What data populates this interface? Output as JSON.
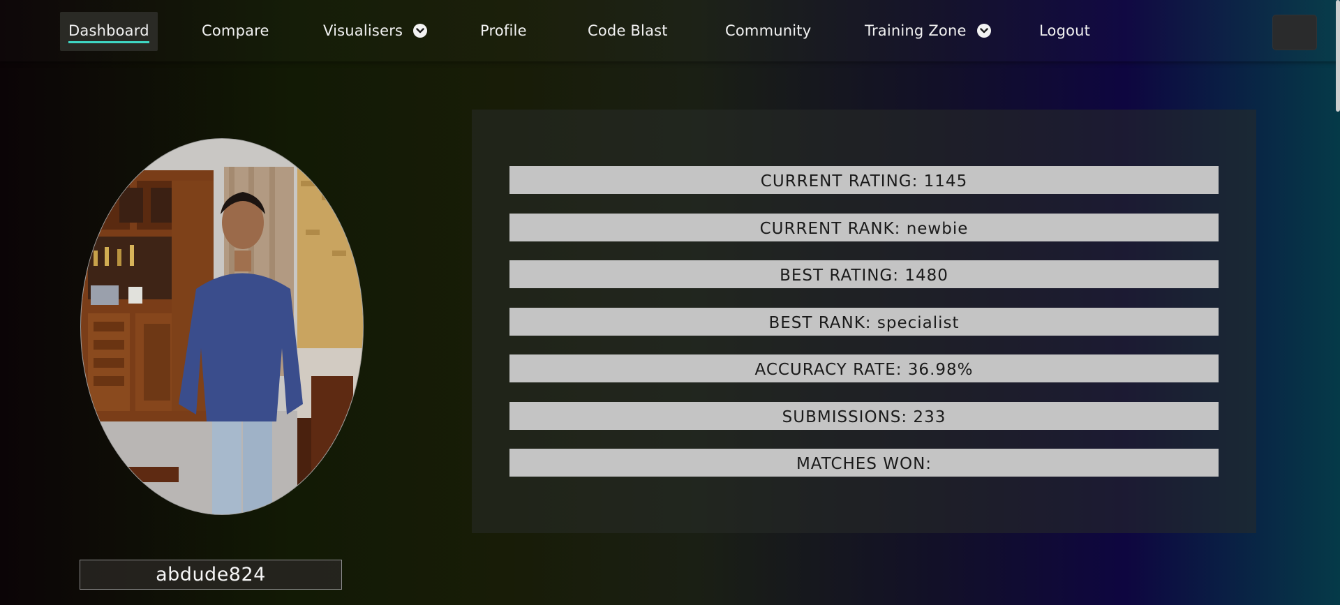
{
  "nav": {
    "items": [
      {
        "label": "Dashboard"
      },
      {
        "label": "Compare"
      },
      {
        "label": "Visualisers"
      },
      {
        "label": "Profile"
      },
      {
        "label": "Code Blast"
      },
      {
        "label": "Community"
      },
      {
        "label": "Training Zone"
      },
      {
        "label": "Logout"
      }
    ]
  },
  "profile": {
    "username": "abdude824"
  },
  "stats": [
    {
      "label": "CURRENT RATING: 1145"
    },
    {
      "label": "CURRENT RANK: newbie"
    },
    {
      "label": "BEST RATING: 1480"
    },
    {
      "label": "BEST RANK: specialist"
    },
    {
      "label": "ACCURACY RATE: 36.98%"
    },
    {
      "label": "SUBMISSIONS: 233"
    },
    {
      "label": "MATCHES WON:"
    }
  ],
  "colors": {
    "active_underline": "#3fd7c4",
    "stat_bar": "#c4c4c4"
  }
}
